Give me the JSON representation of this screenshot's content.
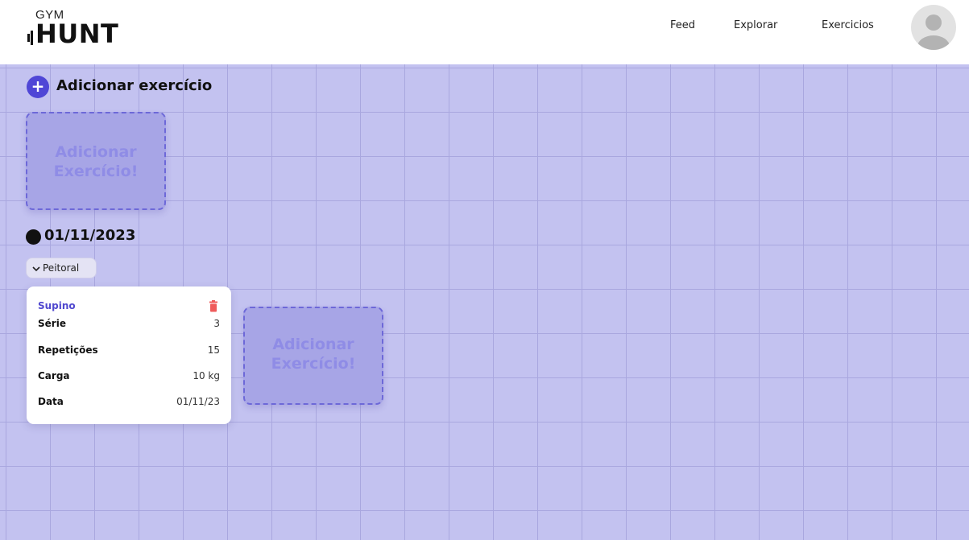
{
  "header": {
    "logo_small": "GYM",
    "logo_big": "HUNT",
    "nav": [
      {
        "label": "Feed"
      },
      {
        "label": "Explorar"
      },
      {
        "label": "Exercicios"
      }
    ],
    "avatar_icon": "user-avatar-icon"
  },
  "main": {
    "add_title": "Adicionar exercício",
    "add_icon": "plus-icon",
    "add_card": {
      "line1": "Adicionar",
      "line2": "Exercício!"
    },
    "sessions": [
      {
        "date": "01/11/2023",
        "groups": [
          {
            "label": "Peitoral",
            "chevron_icon": "chevron-down-icon",
            "exercises": [
              {
                "name": "Supino",
                "delete_icon": "trash-icon",
                "fields": [
                  {
                    "label": "Série",
                    "value": "3"
                  },
                  {
                    "label": "Repetições",
                    "value": "15"
                  },
                  {
                    "label": "Carga",
                    "value": "10 kg"
                  },
                  {
                    "label": "Data",
                    "value": "01/11/23"
                  }
                ]
              }
            ],
            "add_card": {
              "line1": "Adicionar",
              "line2": "Exercício!"
            }
          }
        ]
      }
    ]
  },
  "colors": {
    "board": "#c3c2f0",
    "grid": "#a9a7df",
    "accent": "#4f46d6",
    "delete": "#ef5b5b"
  }
}
